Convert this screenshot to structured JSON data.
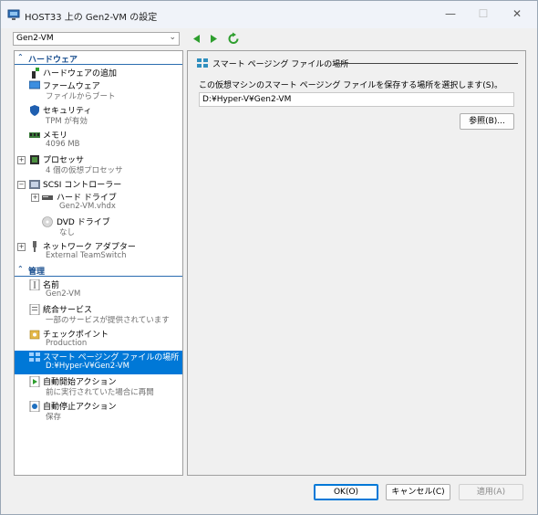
{
  "window": {
    "title": "HOST33 上の Gen2-VM の設定"
  },
  "window_controls": {
    "minimize": "—",
    "maximize": "☐",
    "close": "✕"
  },
  "toolbar": {
    "vm_selected": "Gen2-VM"
  },
  "tree": {
    "hardware_header": "ハードウェア",
    "management_header": "管理",
    "hardware_items": [
      {
        "label": "ハードウェアの追加",
        "sub": ""
      },
      {
        "label": "ファームウェア",
        "sub": "ファイルからブート"
      },
      {
        "label": "セキュリティ",
        "sub": "TPM が有効"
      },
      {
        "label": "メモリ",
        "sub": "4096 MB"
      },
      {
        "label": "プロセッサ",
        "sub": "4 個の仮想プロセッサ"
      },
      {
        "label": "SCSI コントローラー",
        "sub": ""
      },
      {
        "label": "ハード ドライブ",
        "sub": "Gen2-VM.vhdx"
      },
      {
        "label": "DVD ドライブ",
        "sub": "なし"
      },
      {
        "label": "ネットワーク アダプター",
        "sub": "External TeamSwitch"
      }
    ],
    "management_items": [
      {
        "label": "名前",
        "sub": "Gen2-VM"
      },
      {
        "label": "統合サービス",
        "sub": "一部のサービスが提供されています"
      },
      {
        "label": "チェックポイント",
        "sub": "Production"
      },
      {
        "label": "スマート ページング ファイルの場所",
        "sub": "D:¥Hyper-V¥Gen2-VM"
      },
      {
        "label": "自動開始アクション",
        "sub": "前に実行されていた場合に再開"
      },
      {
        "label": "自動停止アクション",
        "sub": "保存"
      }
    ]
  },
  "panel": {
    "header": "スマート ページング ファイルの場所",
    "description": "この仮想マシンのスマート ページング ファイルを保存する場所を選択します(S)。",
    "path_value": "D:¥Hyper-V¥Gen2-VM",
    "browse_label": "参照(B)..."
  },
  "footer": {
    "ok_label": "OK(O)",
    "cancel_label": "キャンセル(C)",
    "apply_label": "適用(A)"
  }
}
